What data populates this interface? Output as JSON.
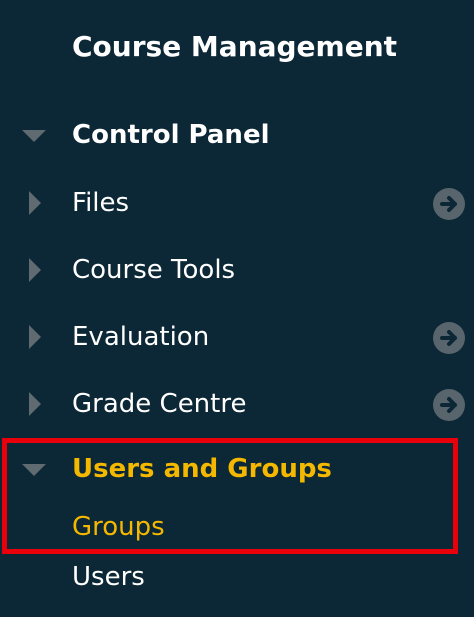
{
  "course_management": {
    "title": "Course Management",
    "control_panel_label": "Control Panel",
    "items": [
      {
        "label": "Files",
        "has_action": true
      },
      {
        "label": "Course Tools",
        "has_action": false
      },
      {
        "label": "Evaluation",
        "has_action": true
      },
      {
        "label": "Grade Centre",
        "has_action": true
      }
    ],
    "users_and_groups": {
      "label": "Users and Groups",
      "subitems": [
        {
          "label": "Groups"
        },
        {
          "label": "Users"
        }
      ]
    }
  },
  "icons": {
    "expanded": "triangle-down-icon",
    "collapsed": "triangle-right-icon",
    "action": "arrow-circle-right-icon"
  },
  "colors": {
    "panel_background": "#0c2735",
    "text": "#ffffff",
    "active_text": "#f5b800",
    "highlight_border": "#e8000b",
    "icon": "#59656c"
  }
}
